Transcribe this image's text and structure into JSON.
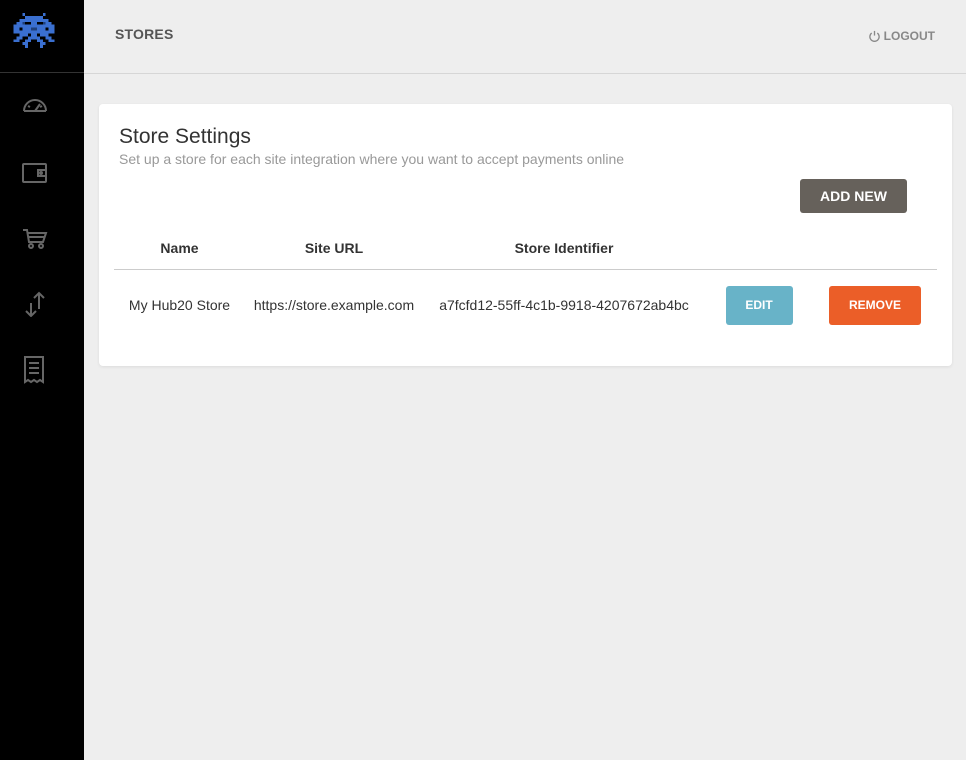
{
  "header": {
    "title": "STORES",
    "logout_label": "LOGOUT"
  },
  "sidebar": {
    "items": [
      {
        "icon": "dashboard-icon"
      },
      {
        "icon": "wallet-icon"
      },
      {
        "icon": "cart-icon"
      },
      {
        "icon": "transfer-icon"
      },
      {
        "icon": "receipt-icon"
      }
    ]
  },
  "card": {
    "title": "Store Settings",
    "subtitle": "Set up a store for each site integration where you want to accept payments online",
    "add_label": "ADD NEW"
  },
  "table": {
    "columns": [
      "Name",
      "Site URL",
      "Store Identifier"
    ],
    "rows": [
      {
        "name": "My Hub20 Store",
        "url": "https://store.example.com",
        "identifier": "a7fcfd12-55ff-4c1b-9918-4207672ab4bc",
        "edit_label": "EDIT",
        "remove_label": "REMOVE"
      }
    ]
  },
  "colors": {
    "sidebar": "#000000",
    "add_button": "#66615b",
    "edit_button": "#68b3c8",
    "remove_button": "#eb5e28",
    "logo": "#3a6fd0"
  }
}
